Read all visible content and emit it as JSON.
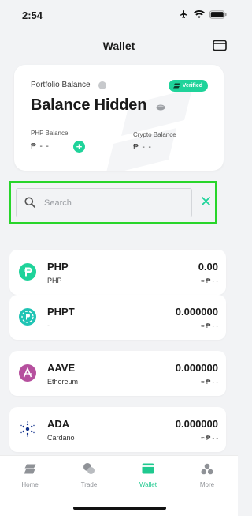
{
  "status_bar": {
    "time": "2:54"
  },
  "header": {
    "title": "Wallet"
  },
  "portfolio": {
    "label": "Portfolio Balance",
    "verified_badge": "Verified",
    "balance_text": "Balance Hidden",
    "php_balance_label": "PHP Balance",
    "php_balance_value": "₱ - -",
    "crypto_balance_label": "Crypto Balance",
    "crypto_balance_value": "₱ - -"
  },
  "search": {
    "placeholder": "Search"
  },
  "assets": [
    {
      "symbol": "PHP",
      "name": "PHP",
      "amount": "0.00",
      "fiat": "≈ ₱ - -",
      "icon": "php-icon",
      "color": "#1fd39a"
    },
    {
      "symbol": "PHPT",
      "name": "-",
      "amount": "0.000000",
      "fiat": "≈ ₱ - -",
      "icon": "phpt-icon",
      "color": "#1fc4b4"
    },
    {
      "symbol": "AAVE",
      "name": "Ethereum",
      "amount": "0.000000",
      "fiat": "≈ ₱ - -",
      "icon": "aave-icon",
      "color": "#b6509e"
    },
    {
      "symbol": "ADA",
      "name": "Cardano",
      "amount": "0.000000",
      "fiat": "≈ ₱ - -",
      "icon": "ada-icon",
      "color": "#0d2e8a"
    }
  ],
  "tabs": [
    {
      "label": "Home",
      "icon": "home-icon",
      "active": false
    },
    {
      "label": "Trade",
      "icon": "trade-icon",
      "active": false
    },
    {
      "label": "Wallet",
      "icon": "wallet-icon",
      "active": true
    },
    {
      "label": "More",
      "icon": "more-icon",
      "active": false
    }
  ],
  "colors": {
    "accent": "#1fd39a",
    "highlight": "#28d52a",
    "background": "#f2f3f5"
  }
}
